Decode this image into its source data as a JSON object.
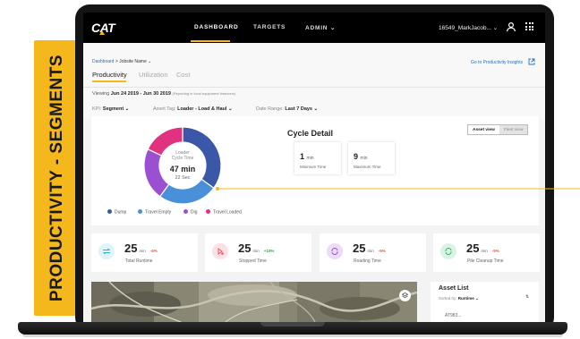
{
  "banner": {
    "text": "PRODUCTIVITY - SEGMENTS"
  },
  "nav": {
    "logo": "CAT",
    "links": [
      "DASHBOARD",
      "TARGETS",
      "ADMIN ⌄"
    ],
    "user": "16549_MarkJacob... ⌄"
  },
  "breadcrumb": {
    "root": "Dashboard",
    "current": "Jobsite Name ⌄"
  },
  "insights_link": "Go to Productivity Insights",
  "tabs": [
    "Productivity",
    "Utilization",
    "Cost"
  ],
  "viewing": {
    "prefix": "Viewing ",
    "range": "Jun 24 2019 - Jun 30 2019",
    "note": "(Reporting in local equipment timezone)"
  },
  "filters": [
    {
      "label": "KPI: ",
      "value": "Segment ⌄"
    },
    {
      "label": "Asset Tag: ",
      "value": "Loader - Load & Haul ⌄"
    },
    {
      "label": "Date Range: ",
      "value": "Last 7 Days ⌄"
    }
  ],
  "cycle": {
    "title": "Cycle Detail",
    "center_label": [
      "Loader",
      "Cycle Time"
    ],
    "center_value": "47 min",
    "center_sub": "22 Sec",
    "min_time": {
      "value": "1",
      "unit": "min",
      "label": "Minimum Time"
    },
    "max_time": {
      "value": "9",
      "unit": "min",
      "label": "Maximum Time"
    },
    "view_toggle": [
      "Asset view",
      "Fleet view"
    ]
  },
  "chart_data": {
    "type": "pie",
    "title": "",
    "labels": [
      "Dump",
      "Travel Empty",
      "Dig",
      "Travel Loaded"
    ],
    "values": [
      35,
      25,
      22,
      18
    ],
    "colors": [
      "#3a57a8",
      "#4a90d9",
      "#9b4fd1",
      "#e0327f"
    ]
  },
  "kpis": [
    {
      "value": "25",
      "unit": "min",
      "change": "-5%",
      "label": "Total Runtime",
      "change_color": "#e05a2b",
      "icon_bg": "#dff4f8",
      "icon_color": "#38b1c9"
    },
    {
      "value": "25",
      "unit": "min",
      "change": "+10%",
      "label": "Stopped Time",
      "change_color": "#2aa84a",
      "icon_bg": "#fde1e4",
      "icon_color": "#e85567"
    },
    {
      "value": "25",
      "unit": "min",
      "change": "-5%",
      "label": "Roading Time",
      "change_color": "#e05a2b",
      "icon_bg": "#ecdcf7",
      "icon_color": "#9b4fd1"
    },
    {
      "value": "25",
      "unit": "min",
      "change": "-5%",
      "label": "Pile Cleanup Time",
      "change_color": "#e05a2b",
      "icon_bg": "#daf4e4",
      "icon_color": "#3ab26a"
    }
  ],
  "asset_list": {
    "title": "Asset List",
    "sort_prefix": "Sorted by: ",
    "sort_value": "Runtime ⌄",
    "first_row": "AT983..."
  }
}
